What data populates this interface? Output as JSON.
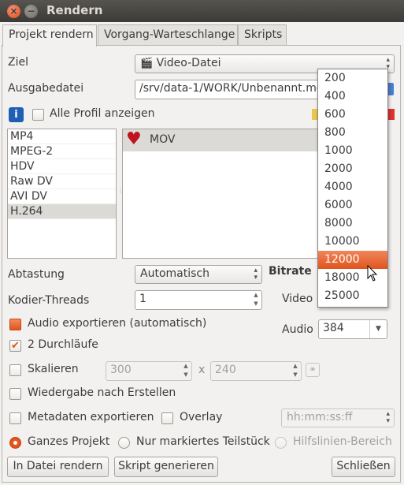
{
  "window": {
    "title": "Rendern"
  },
  "tabs": [
    "Projekt rendern",
    "Vorgang-Warteschlange",
    "Skripts"
  ],
  "target": {
    "label": "Ziel",
    "value": "Video-Datei"
  },
  "output": {
    "label": "Ausgabedatei",
    "value": "/srv/data-1/WORK/Unbenannt.mov"
  },
  "profiles": {
    "show_all_label": "Alle Profil anzeigen",
    "show_all_checked": false
  },
  "formats": [
    "MP4",
    "MPEG-2",
    "HDV",
    "Raw DV",
    "AVI DV",
    "H.264"
  ],
  "selected_format": "H.264",
  "profile_list": [
    {
      "name": "MOV",
      "icon": "heart-icon"
    }
  ],
  "sampling": {
    "label": "Abtastung",
    "value": "Automatisch"
  },
  "threads": {
    "label": "Kodier-Threads",
    "value": "1"
  },
  "bitrate": {
    "heading": "Bitrate",
    "video_label": "Video",
    "audio_label": "Audio",
    "audio_value": "384",
    "options": [
      "200",
      "400",
      "600",
      "800",
      "1000",
      "2000",
      "4000",
      "6000",
      "8000",
      "10000",
      "12000",
      "18000",
      "25000"
    ],
    "highlighted": "12000"
  },
  "audio_export": {
    "label": "Audio exportieren (automatisch)",
    "checked": true
  },
  "two_pass": {
    "label": "2 Durchläufe",
    "checked": true
  },
  "scale": {
    "label": "Skalieren",
    "checked": false,
    "width": "300",
    "x": "x",
    "height": "240"
  },
  "play_after": {
    "label": "Wiedergabe nach Erstellen",
    "checked": false
  },
  "metadata": {
    "label": "Metadaten exportieren",
    "checked": false
  },
  "overlay": {
    "label": "Overlay",
    "checked": false,
    "placeholder": "hh:mm:ss:ff"
  },
  "range": {
    "whole": "Ganzes Projekt",
    "marked": "Nur markiertes Teilstück",
    "guides": "Hilfslinien-Bereich",
    "selected": "whole"
  },
  "buttons": {
    "render": "In Datei rendern",
    "script": "Skript generieren",
    "close": "Schließen"
  },
  "colors": {
    "accent": "#e2541d",
    "titlebar": "#3c3b37",
    "background": "#f2f1f0"
  }
}
